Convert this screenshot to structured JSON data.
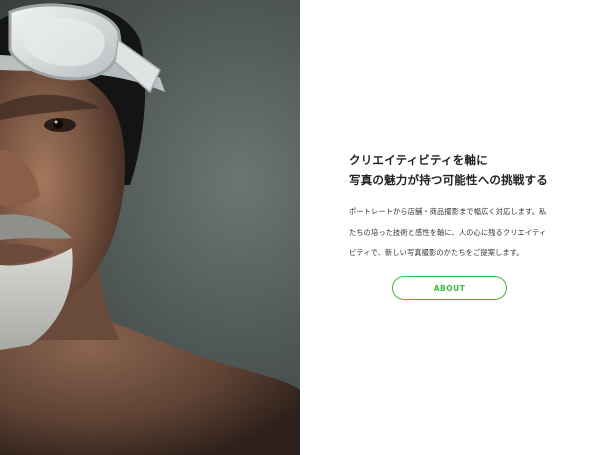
{
  "hero": {
    "image_alt": "portrait-photo"
  },
  "content": {
    "heading_lines": [
      "クリエイティビティを軸に",
      "写真の魅力が持つ可能性への挑戦する"
    ],
    "body_lines": [
      "ポートレートから店舗・商品撮影まで幅広く対応します。私",
      "たちの培った技術と感性を軸に、人の心に残るクリエイティ",
      "ビティで、新しい写真撮影のかたちをご提案します。"
    ],
    "about_button_label": "ABOUT"
  },
  "colors": {
    "accent": "#3cba3c",
    "text": "#222222",
    "background": "#ffffff"
  }
}
